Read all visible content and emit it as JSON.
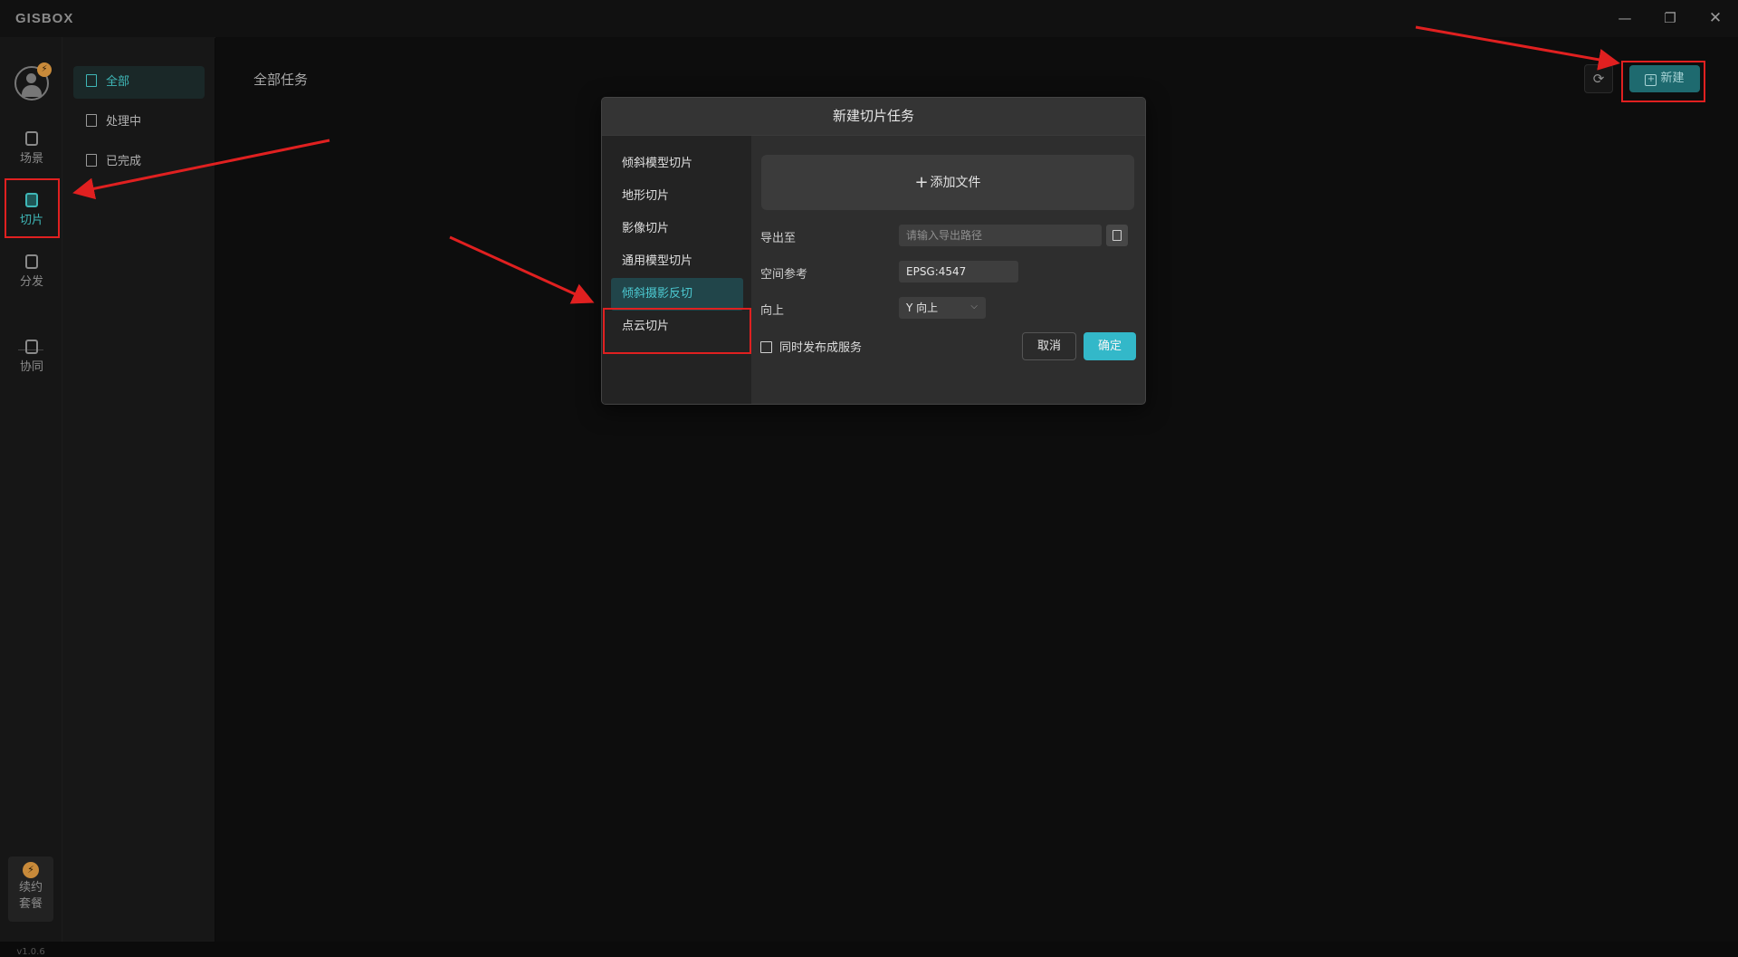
{
  "app": {
    "logo": "GISBOX"
  },
  "window_controls": {
    "minimize": "—",
    "maximize": "❐",
    "close": "✕"
  },
  "rail": {
    "badge": "⚡",
    "items": [
      {
        "label": "场景"
      },
      {
        "label": "切片"
      },
      {
        "label": "分发"
      },
      {
        "label": "协同"
      }
    ],
    "renew": {
      "line1": "续约",
      "line2": "套餐",
      "icon": "⚡"
    },
    "version": "v1.0.6"
  },
  "subnav": {
    "items": [
      {
        "label": "全部"
      },
      {
        "label": "处理中"
      },
      {
        "label": "已完成"
      }
    ]
  },
  "main": {
    "title": "全部任务",
    "refresh_icon": "⟳",
    "new_button": "新建"
  },
  "modal": {
    "title": "新建切片任务",
    "types": [
      {
        "label": "倾斜模型切片"
      },
      {
        "label": "地形切片"
      },
      {
        "label": "影像切片"
      },
      {
        "label": "通用模型切片"
      },
      {
        "label": "倾斜摄影反切"
      },
      {
        "label": "点云切片"
      }
    ],
    "selected_type": "倾斜摄影反切",
    "add_file": "添加文件",
    "export_label": "导出至",
    "export_placeholder": "请输入导出路径",
    "srs_label": "空间参考",
    "srs_value": "EPSG:4547",
    "up_label": "向上",
    "up_value": "Y 向上",
    "publish_label": "同时发布成服务",
    "cancel": "取消",
    "confirm": "确定"
  },
  "colors": {
    "accent": "#3fb7b7",
    "confirm": "#33b8c9",
    "annotation": "#e02020"
  }
}
